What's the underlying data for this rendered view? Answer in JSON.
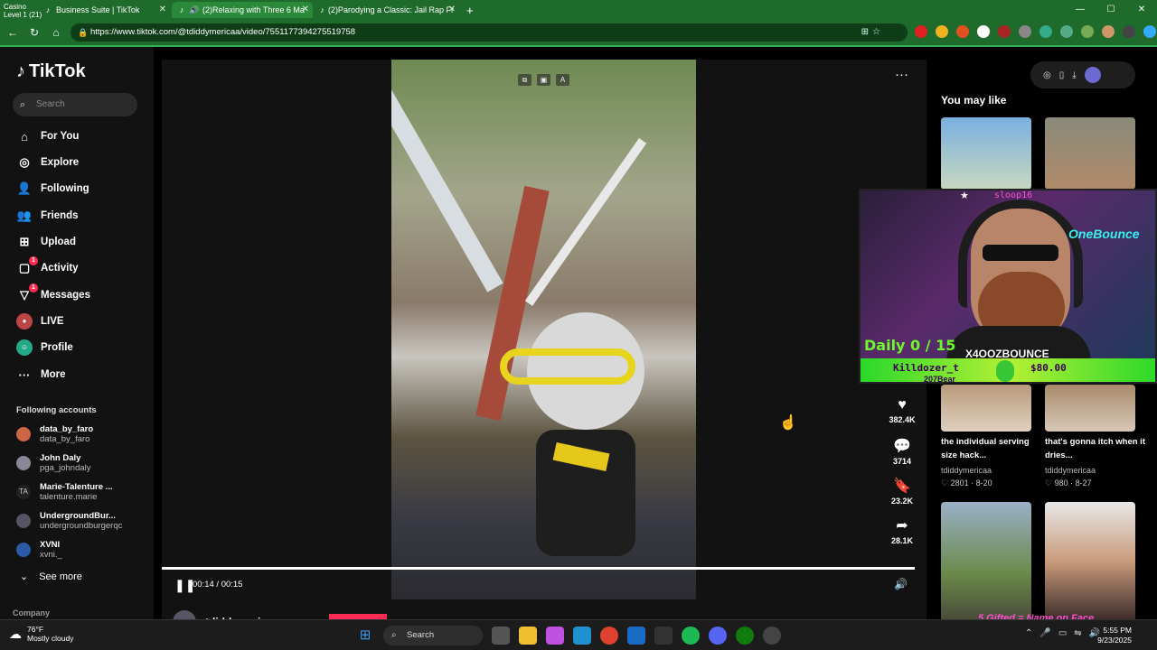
{
  "browser": {
    "stream_overlay": {
      "line1": "Casino",
      "line2": "Level 1  (21)"
    },
    "tabs": [
      {
        "title": "Business Suite | TikTok"
      },
      {
        "title": "(2)Relaxing with Three 6 Ma"
      },
      {
        "title": "(2)Parodying a Classic: Jail Rap Fr"
      }
    ],
    "new_tab": "+",
    "url": "https://www.tiktok.com/@tdiddymericaa/video/7551177394275519758",
    "window_controls": [
      "—",
      "☐",
      "✕"
    ]
  },
  "tiktok": {
    "logo": "TikTok",
    "search_placeholder": "Search",
    "nav": [
      {
        "label": "For You",
        "icon": "⌂"
      },
      {
        "label": "Explore",
        "icon": "◎"
      },
      {
        "label": "Following",
        "icon": "👤"
      },
      {
        "label": "Friends",
        "icon": "👥"
      },
      {
        "label": "Upload",
        "icon": "⊞"
      },
      {
        "label": "Activity",
        "icon": "▢",
        "badge": "1"
      },
      {
        "label": "Messages",
        "icon": "▽",
        "badge": "1"
      },
      {
        "label": "LIVE",
        "icon": "●"
      },
      {
        "label": "Profile",
        "icon": "☺"
      },
      {
        "label": "More",
        "icon": "···"
      }
    ],
    "following_title": "Following accounts",
    "following": [
      {
        "name": "data_by_faro",
        "handle": "data_by_faro"
      },
      {
        "name": "John Daly",
        "handle": "pga_johndaly"
      },
      {
        "name": "Marie-Talenture ...",
        "handle": "talenture.marie",
        "initials": "TA"
      },
      {
        "name": "UndergroundBur...",
        "handle": "undergroundburgerqc"
      },
      {
        "name": "XVNI",
        "handle": "xvni._"
      }
    ],
    "see_more": "See more",
    "company": "Company",
    "video": {
      "time": "00:14 / 00:15",
      "progress": 0.985,
      "author": "tdiddymericaa"
    },
    "actions": [
      {
        "icon": "♥",
        "count": "382.4K"
      },
      {
        "icon": "💬",
        "count": "3714"
      },
      {
        "icon": "🔖",
        "count": "23.2K"
      },
      {
        "icon": "➦",
        "count": "28.1K"
      }
    ],
    "you_may_like": "You may like",
    "recommendations": [
      {
        "title": "the individual serving size hack...",
        "author": "tdiddymericaa",
        "views": "2801",
        "date": "8-20"
      },
      {
        "title": "that's gonna itch when it dries...",
        "author": "tdiddymericaa",
        "views": "980",
        "date": "8-27"
      }
    ]
  },
  "stream_cam": {
    "streamer_name": "sloop16",
    "sign": "OneBounce",
    "daily": "Daily 0 / 15",
    "user": "X4OOZBOUNCE",
    "killdozer": "Killdozer_t",
    "amount": "$80.00",
    "bear": "207Bear",
    "gift_text": "5 Gifted = Name on Face"
  },
  "taskbar": {
    "temp": "76°F",
    "weather": "Mostly cloudy",
    "search": "Search",
    "time": "5:55 PM",
    "date": "9/23/2025"
  }
}
